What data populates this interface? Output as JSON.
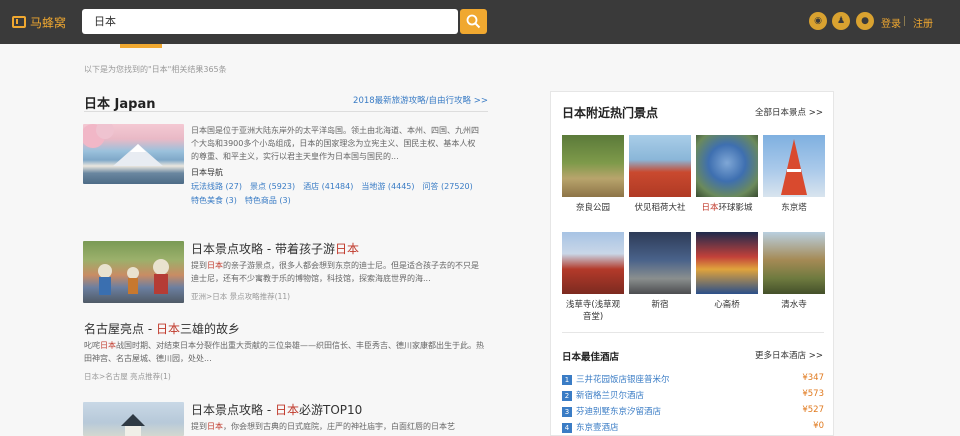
{
  "header": {
    "logo_text": "马蜂窝",
    "search_value": "日本",
    "login_label": "登录",
    "register_label": "注册",
    "social_icons": [
      "weibo-icon",
      "qq-icon",
      "wechat-icon"
    ],
    "accent_color": "#f0a830"
  },
  "results": {
    "count_text": "以下是为您找到的\"日本\"相关结果365条"
  },
  "main": {
    "section_title": "日本 Japan",
    "section_link": "2018最新旅游攻略/自由行攻略 >>",
    "overview": {
      "body": "日本国是位于亚洲大陆东岸外的太平洋岛国。领土由北海道、本州、四国、九州四个大岛和3900多个小岛组成，日本的国家理念为立宪主义、国民主权、基本人权的尊重、和平主义，实行以君主天皇作为日本国与国民的...",
      "nav_label": "日本导航",
      "links": [
        "玩法线路 (27)",
        "景点 (5923)",
        "酒店 (41484)",
        "当地游 (4445)",
        "问答 (27520)"
      ],
      "links2": [
        "特色美食 (3)",
        "特色商品 (3)"
      ]
    },
    "articles": [
      {
        "title_prefix": "日本景点攻略 - 带着孩子游",
        "title_hl": "日本",
        "title_suffix": "",
        "body_a": "提到",
        "body_hl": "日本",
        "body_b": "的亲子游景点，很多人都会想到东京的迪士尼。但是适合孩子去的不只是迪士尼，还有不少寓教于乐的博物馆，科技馆，探索海底世界的海...",
        "meta": "亚洲>日本   景点攻略推荐(11)"
      },
      {
        "title_prefix": "名古屋亮点 - ",
        "title_hl": "日本",
        "title_suffix": "三雄的故乡",
        "body_a": "叱咤",
        "body_hl": "日本",
        "body_b": "战国时期、对结束日本分裂作出重大贡献的三位枭雄——织田信长、丰臣秀吉、德川家康都出生于此。热田神宫、名古屋城、德川园，处处...",
        "meta": "日本>名古屋   亮点推荐(1)"
      },
      {
        "title_prefix": "日本景点攻略 - ",
        "title_hl": "日本",
        "title_suffix": "必游TOP10",
        "body_a": "提到",
        "body_hl": "日本",
        "body_b": "，你会想到古典的日式庭院，庄严的神社庙宇，白面红唇的日本艺",
        "meta": ""
      }
    ]
  },
  "sidebar": {
    "title": "日本附近热门景点",
    "all_link": "全部日本景点 >>",
    "spots": [
      {
        "name": "奈良公园"
      },
      {
        "name": "伏见稻荷大社"
      },
      {
        "name_hl": "日本",
        "name": "环球影城"
      },
      {
        "name": "东京塔"
      },
      {
        "name": "浅草寺(浅草观音堂)"
      },
      {
        "name": "新宿"
      },
      {
        "name": "心斋桥"
      },
      {
        "name": "清水寺"
      }
    ],
    "hotels_title": "日本最佳酒店",
    "hotels_link": "更多日本酒店 >>",
    "hotels": [
      {
        "rank": "1",
        "name": "三井花园饭店银座普米尔",
        "price": "¥347"
      },
      {
        "rank": "2",
        "name": "新宿格兰贝尔酒店",
        "price": "¥573"
      },
      {
        "rank": "3",
        "name": "芬迪别墅东京汐留酒店",
        "price": "¥527"
      },
      {
        "rank": "4",
        "name": "东京壹酒店",
        "price": "¥0"
      }
    ]
  }
}
